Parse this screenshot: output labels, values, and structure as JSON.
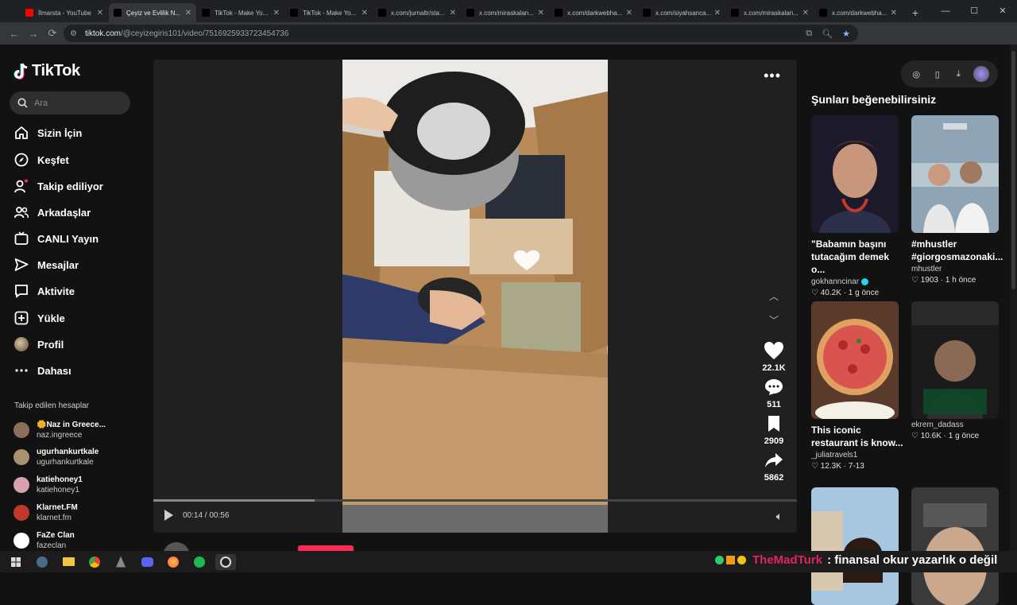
{
  "browser": {
    "tabs": [
      {
        "title": "İlmarsta - YouTube",
        "fav": "#ff0000",
        "active": false
      },
      {
        "title": "Çeyiz ve Evlilik N...",
        "fav": "#000000",
        "active": true
      },
      {
        "title": "TikTok - Make Yo...",
        "fav": "#000000",
        "active": false
      },
      {
        "title": "TikTok - Make Yo...",
        "fav": "#000000",
        "active": false
      },
      {
        "title": "x.com/jurnaltr/sta...",
        "fav": "#000000",
        "active": false
      },
      {
        "title": "x.com/miraskalan...",
        "fav": "#000000",
        "active": false
      },
      {
        "title": "x.com/darkwebha...",
        "fav": "#000000",
        "active": false
      },
      {
        "title": "x.com/siyahsanca...",
        "fav": "#000000",
        "active": false
      },
      {
        "title": "x.com/miraskalan...",
        "fav": "#000000",
        "active": false
      },
      {
        "title": "x.com/darkwebha...",
        "fav": "#000000",
        "active": false
      }
    ],
    "url_host": "tiktok.com",
    "url_path": "/@ceyizegiris101/video/7516925933723454736"
  },
  "sidebar": {
    "logo": "TikTok",
    "search_placeholder": "Ara",
    "nav": [
      {
        "label": "Sizin İçin",
        "icon": "home-icon"
      },
      {
        "label": "Keşfet",
        "icon": "compass-icon"
      },
      {
        "label": "Takip ediliyor",
        "icon": "following-icon"
      },
      {
        "label": "Arkadaşlar",
        "icon": "friends-icon"
      },
      {
        "label": "CANLI Yayın",
        "icon": "live-icon"
      },
      {
        "label": "Mesajlar",
        "icon": "messages-icon"
      },
      {
        "label": "Aktivite",
        "icon": "activity-icon"
      },
      {
        "label": "Yükle",
        "icon": "upload-icon"
      },
      {
        "label": "Profil",
        "icon": "profile-icon"
      },
      {
        "label": "Dahası",
        "icon": "more-icon"
      }
    ],
    "following_title": "Takip edilen hesaplar",
    "accounts": [
      {
        "name": "🌼Naz in Greece...",
        "handle": "naz.ingreece",
        "color": "#8b6f5c"
      },
      {
        "name": "ugurhankurtkale",
        "handle": "ugurhankurtkale",
        "color": "#a89070"
      },
      {
        "name": "katiehoney1",
        "handle": "katiehoney1",
        "color": "#d9a0b0"
      },
      {
        "name": "Klarnet.FM",
        "handle": "klarnet.fm",
        "color": "#c0392b"
      },
      {
        "name": "FaZe Clan",
        "handle": "fazeclan",
        "color": "#ffffff"
      }
    ]
  },
  "video": {
    "current_time": "00:14",
    "duration": "00:56",
    "progress": 0.25,
    "likes": "22.1K",
    "comments": "511",
    "saves": "2909",
    "shares": "5862",
    "author": "ceyizegiris101"
  },
  "recommendations": {
    "title": "Şunları beğenebilirsiniz",
    "cards": [
      {
        "title": "\"Babamın başını tutacağım demek o...",
        "user": "gokhanncinar",
        "verified": true,
        "likes": "40.2K",
        "age": "1 g önce",
        "thumb": "woman"
      },
      {
        "title": "#mhustler #giorgosmazonaki...",
        "user": "mhustler",
        "verified": false,
        "likes": "1903",
        "age": "1 h önce",
        "thumb": "couple"
      },
      {
        "title": "This iconic restaurant is know...",
        "user": "_juliatravels1",
        "verified": false,
        "likes": "12.3K",
        "age": "7-13",
        "thumb": "pizza"
      },
      {
        "title": "",
        "user": "ekrem_dadass",
        "verified": false,
        "likes": "10.6K",
        "age": "1 g önce",
        "thumb": "news"
      },
      {
        "title": "",
        "user": "",
        "verified": false,
        "likes": "",
        "age": "",
        "thumb": "girl"
      },
      {
        "title": "",
        "user": "",
        "verified": false,
        "likes": "",
        "age": "",
        "thumb": "face"
      }
    ]
  },
  "stream_overlay": {
    "user": "TheMadTurk",
    "message": ": finansal okur yazarlık o değil"
  }
}
